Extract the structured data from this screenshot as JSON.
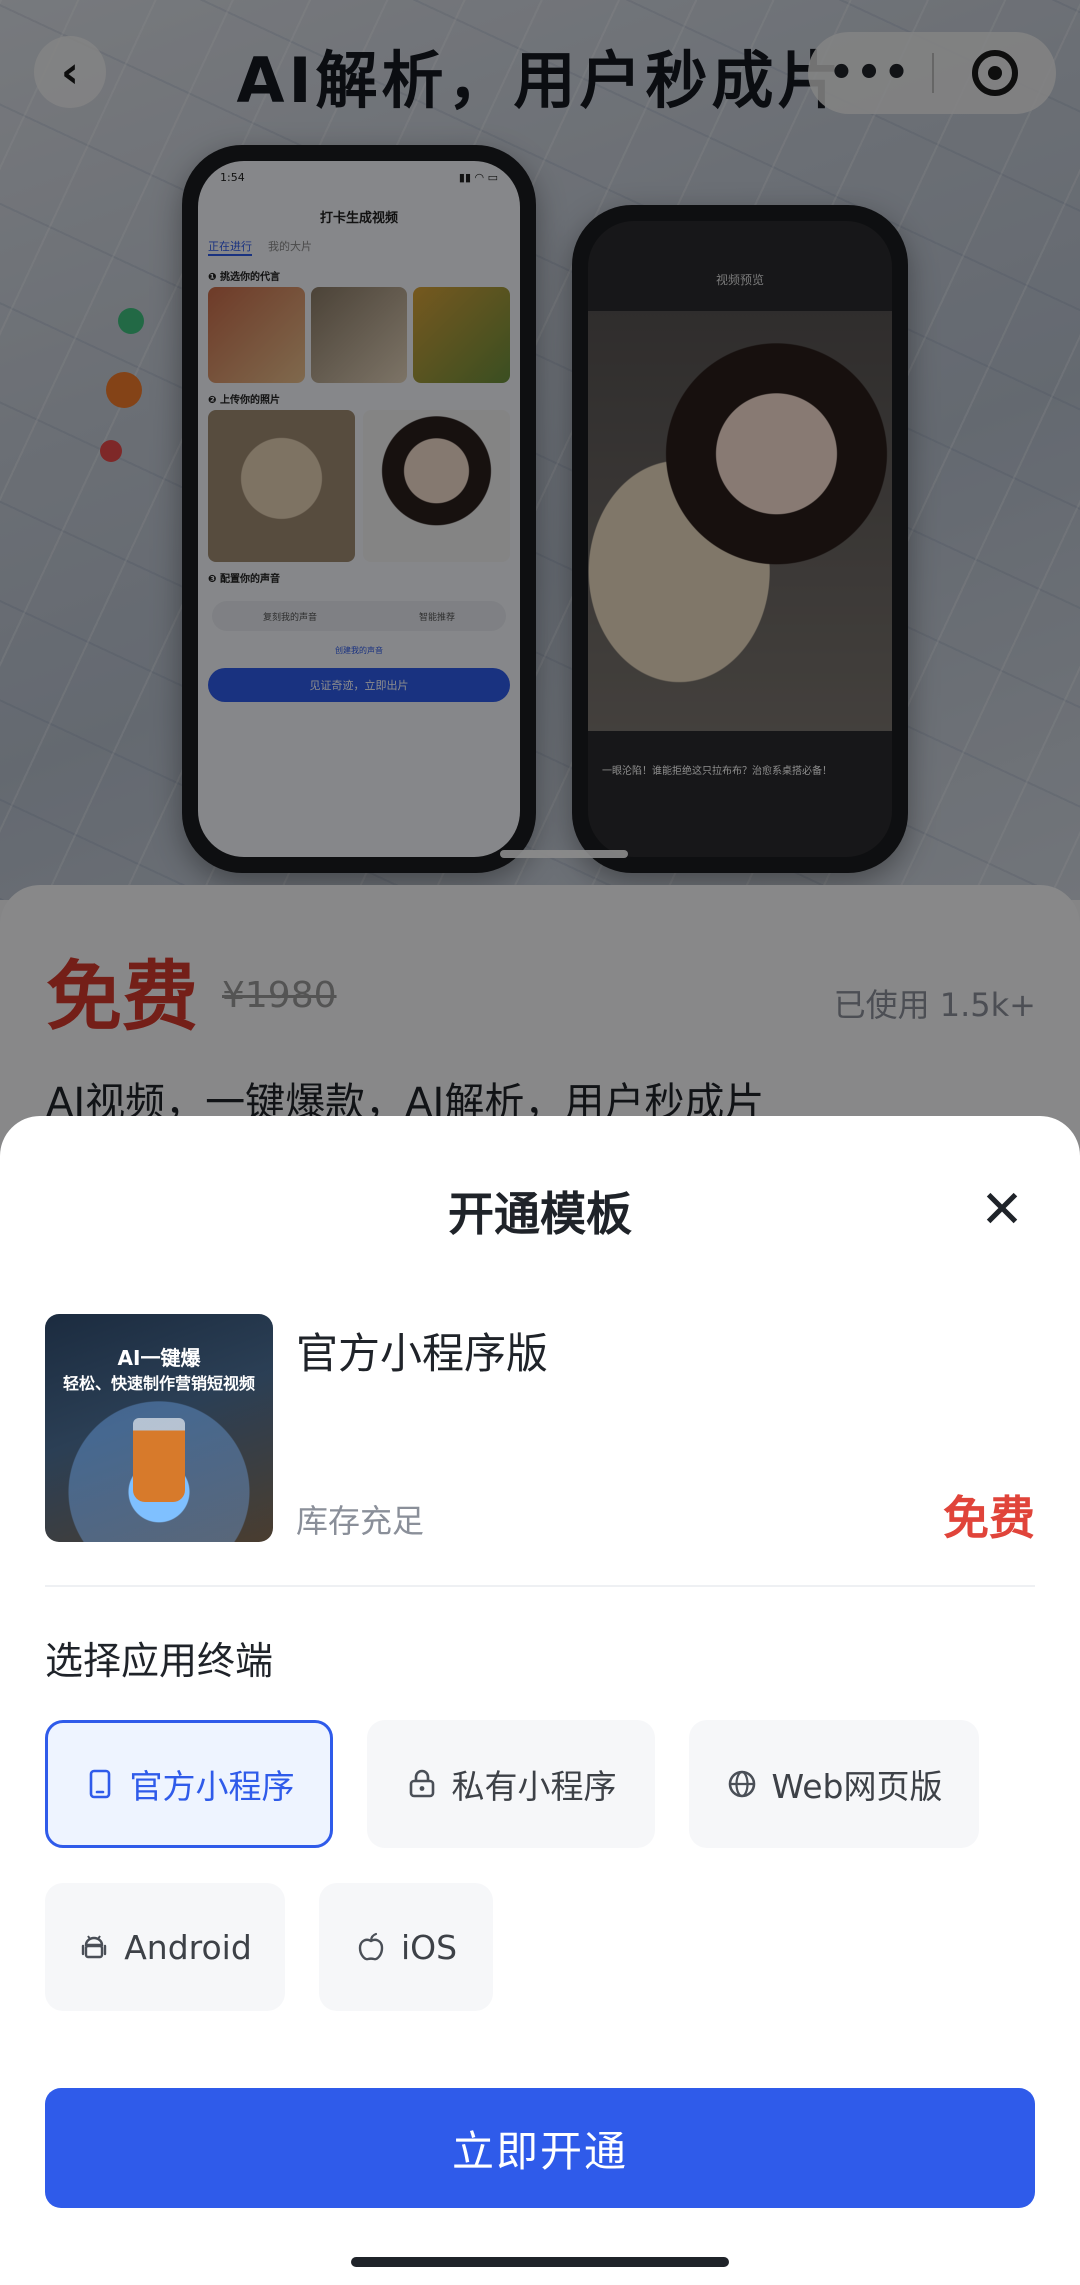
{
  "hero": {
    "title": "AI解析，用户秒成片",
    "phone1": {
      "time": "1:54",
      "nav_title": "打卡生成视频",
      "tab_active": "正在进行",
      "tab_other": "我的大片",
      "step1": "❶ 挑选你的代言",
      "step2": "❷ 上传你的照片",
      "step3": "❸ 配置你的声音",
      "voice_a": "复刻我的声音",
      "voice_b": "智能推荐",
      "create_voice": "创建我的声音",
      "cta": "见证奇迹，立即出片"
    },
    "phone2": {
      "nav_title": "视频预览",
      "caption": "一眼沦陷！谁能拒绝这只拉布布？治愈系桌搭必备！"
    }
  },
  "product": {
    "price": "免费",
    "original_price": "¥1980",
    "used": "已使用 1.5k+",
    "description": "AI视频，一键爆款，AI解析，用户秒成片"
  },
  "sheet": {
    "title": "开通模板",
    "item": {
      "thumb_line1": "AI一键爆",
      "thumb_line2": "轻松、快速制作营销短视频",
      "name": "官方小程序版",
      "stock": "库存充足",
      "price": "免费"
    },
    "terminal_label": "选择应用终端",
    "options": [
      {
        "label": "官方小程序",
        "icon": "phone-icon",
        "selected": true
      },
      {
        "label": "私有小程序",
        "icon": "lock-icon",
        "selected": false
      },
      {
        "label": "Web网页版",
        "icon": "globe-icon",
        "selected": false
      },
      {
        "label": "Android",
        "icon": "android-icon",
        "selected": false
      },
      {
        "label": "iOS",
        "icon": "apple-icon",
        "selected": false
      }
    ],
    "confirm_label": "立即开通"
  },
  "colors": {
    "accent": "#2f5bea",
    "price_red": "#e0443a"
  }
}
